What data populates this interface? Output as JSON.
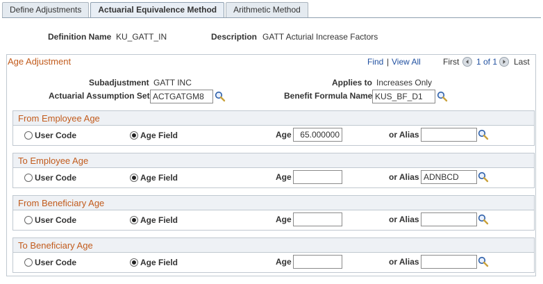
{
  "tabs": [
    {
      "label": "Define Adjustments"
    },
    {
      "label": "Actuarial Equivalence Method"
    },
    {
      "label": "Arithmetic Method"
    }
  ],
  "header": {
    "definition_name_label": "Definition Name",
    "definition_name_value": "KU_GATT_IN",
    "description_label": "Description",
    "description_value": "GATT Acturial Increase Factors"
  },
  "age_adjustment": {
    "title": "Age Adjustment",
    "nav": {
      "find": "Find",
      "sep": "|",
      "view_all": "View All",
      "first": "First",
      "count": "1 of 1",
      "last": "Last"
    },
    "subadjustment_label": "Subadjustment",
    "subadjustment_value": "GATT INC",
    "applies_to_label": "Applies to",
    "applies_to_value": "Increases Only",
    "assumption_label": "Actuarial Assumption Set",
    "assumption_value": "ACTGATGM8",
    "formula_label": "Benefit Formula Name",
    "formula_value": "KUS_BF_D1"
  },
  "sections": [
    {
      "title": "From Employee Age",
      "user_code": "User Code",
      "age_field": "Age Field",
      "age_label": "Age",
      "age_value": "65.000000",
      "alias_label": "or Alias",
      "alias_value": "",
      "selected": "age_field"
    },
    {
      "title": "To Employee Age",
      "user_code": "User Code",
      "age_field": "Age Field",
      "age_label": "Age",
      "age_value": "",
      "alias_label": "or Alias",
      "alias_value": "ADNBCD",
      "selected": "age_field"
    },
    {
      "title": "From Beneficiary Age",
      "user_code": "User Code",
      "age_field": "Age Field",
      "age_label": "Age",
      "age_value": "",
      "alias_label": "or Alias",
      "alias_value": "",
      "selected": "age_field"
    },
    {
      "title": "To Beneficiary Age",
      "user_code": "User Code",
      "age_field": "Age Field",
      "age_label": "Age",
      "age_value": "",
      "alias_label": "or Alias",
      "alias_value": "",
      "selected": "age_field"
    }
  ]
}
